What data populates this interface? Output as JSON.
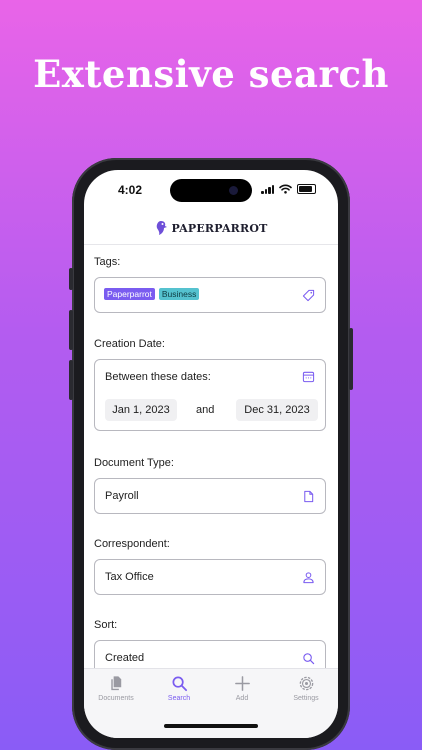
{
  "headline": "Extensive search",
  "status": {
    "time": "4:02"
  },
  "app": {
    "brand": "PAPERPARROT"
  },
  "form": {
    "tags_label": "Tags:",
    "tags": [
      {
        "name": "Paperparrot",
        "color": "#7a5cf0"
      },
      {
        "name": "Business",
        "color": "#55c2cf"
      }
    ],
    "creation_label": "Creation Date:",
    "date_mode": "Between these dates:",
    "date_from": "Jan 1, 2023",
    "date_and": "and",
    "date_to": "Dec 31, 2023",
    "doctype_label": "Document Type:",
    "doctype_value": "Payroll",
    "correspondent_label": "Correspondent:",
    "correspondent_value": "Tax Office",
    "sort_label": "Sort:",
    "sort_value": "Created"
  },
  "tabs": [
    {
      "label": "Documents",
      "icon": "documents-icon",
      "active": false
    },
    {
      "label": "Search",
      "icon": "search-icon",
      "active": true
    },
    {
      "label": "Add",
      "icon": "plus-icon",
      "active": false
    },
    {
      "label": "Settings",
      "icon": "gear-icon",
      "active": false
    }
  ],
  "colors": {
    "accent": "#7a5cf0",
    "background_top": "#e964e8",
    "background_bottom": "#8a5cf6"
  }
}
